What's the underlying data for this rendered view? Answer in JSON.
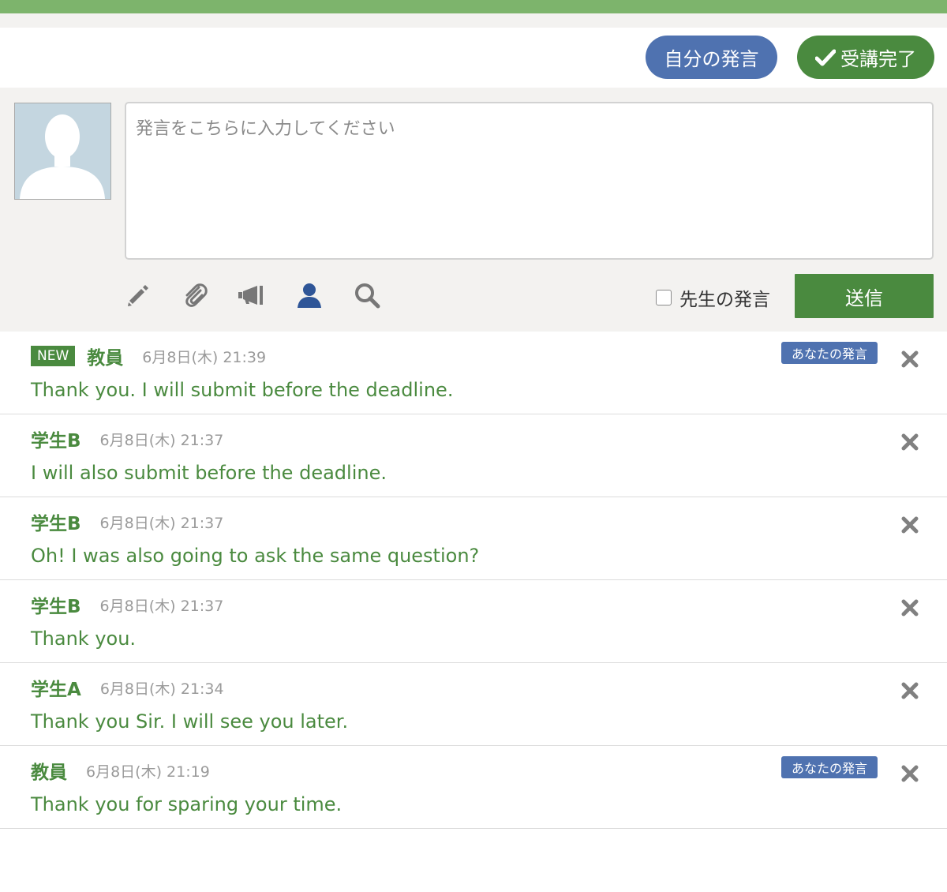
{
  "header": {
    "my_posts_label": "自分の発言",
    "complete_label": "受講完了"
  },
  "composer": {
    "placeholder": "発言をこちらに入力してください",
    "teacher_only_label": "先生の発言",
    "send_label": "送信"
  },
  "toolbar": {
    "icons": [
      "pencil-icon",
      "paperclip-icon",
      "megaphone-icon",
      "person-icon",
      "search-icon"
    ]
  },
  "colors": {
    "accent_green": "#4a8a3f",
    "top_green": "#7db46c",
    "accent_blue": "#4f72b0"
  },
  "messages": [
    {
      "is_new": true,
      "new_label": "NEW",
      "author": "教員",
      "timestamp": "6月8日(木) 21:39",
      "text": "Thank you. I will submit before the deadline.",
      "mine": true,
      "mine_label": "あなたの発言"
    },
    {
      "is_new": false,
      "author": "学生B",
      "timestamp": "6月8日(木) 21:37",
      "text": "I will also submit before the deadline.",
      "mine": false
    },
    {
      "is_new": false,
      "author": "学生B",
      "timestamp": "6月8日(木) 21:37",
      "text": "Oh! I was also going to ask the same question?",
      "mine": false
    },
    {
      "is_new": false,
      "author": "学生B",
      "timestamp": "6月8日(木) 21:37",
      "text": "Thank you.",
      "mine": false
    },
    {
      "is_new": false,
      "author": "学生A",
      "timestamp": "6月8日(木) 21:34",
      "text": "Thank you Sir. I will see you later.",
      "mine": false
    },
    {
      "is_new": false,
      "author": "教員",
      "timestamp": "6月8日(木) 21:19",
      "text": "Thank you for sparing your time.",
      "mine": true,
      "mine_label": "あなたの発言"
    }
  ]
}
